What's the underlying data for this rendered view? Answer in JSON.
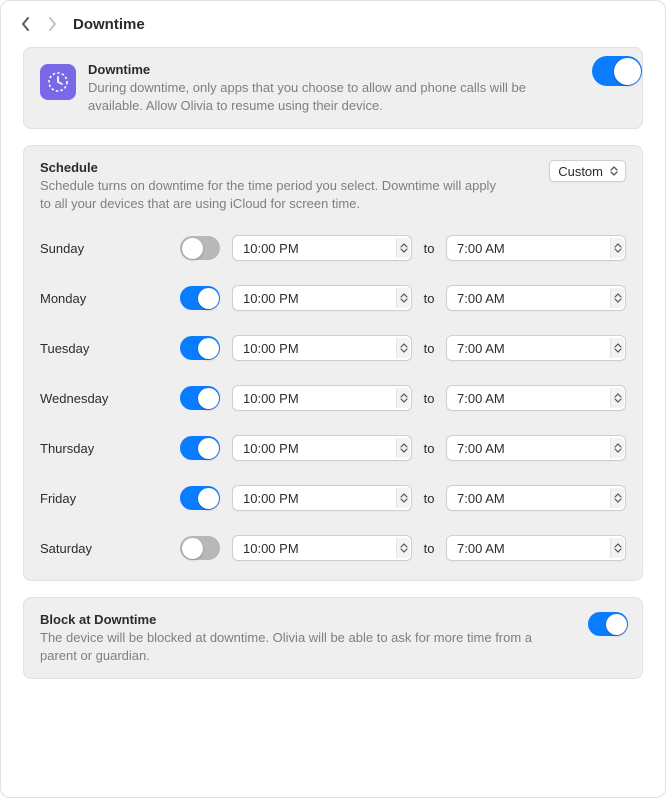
{
  "title": "Downtime",
  "downtime_card": {
    "title": "Downtime",
    "desc": "During downtime, only apps that you choose to allow and phone calls will be available. Allow Olivia to resume using their device.",
    "enabled": true
  },
  "schedule": {
    "title": "Schedule",
    "desc": "Schedule turns on downtime for the time period you select. Downtime will apply to all your devices that are using iCloud for screen time.",
    "mode": "Custom",
    "to_label": "to",
    "days": [
      {
        "name": "Sunday",
        "enabled": false,
        "from": "10:00 PM",
        "to": "7:00 AM"
      },
      {
        "name": "Monday",
        "enabled": true,
        "from": "10:00 PM",
        "to": "7:00 AM"
      },
      {
        "name": "Tuesday",
        "enabled": true,
        "from": "10:00 PM",
        "to": "7:00 AM"
      },
      {
        "name": "Wednesday",
        "enabled": true,
        "from": "10:00 PM",
        "to": "7:00 AM"
      },
      {
        "name": "Thursday",
        "enabled": true,
        "from": "10:00 PM",
        "to": "7:00 AM"
      },
      {
        "name": "Friday",
        "enabled": true,
        "from": "10:00 PM",
        "to": "7:00 AM"
      },
      {
        "name": "Saturday",
        "enabled": false,
        "from": "10:00 PM",
        "to": "7:00 AM"
      }
    ]
  },
  "block": {
    "title": "Block at Downtime",
    "desc": "The device will be blocked at downtime. Olivia will be able to ask for more time from a parent or guardian.",
    "enabled": true
  },
  "colors": {
    "accent": "#0a7cff",
    "icon_bg": "#7a69e6"
  }
}
